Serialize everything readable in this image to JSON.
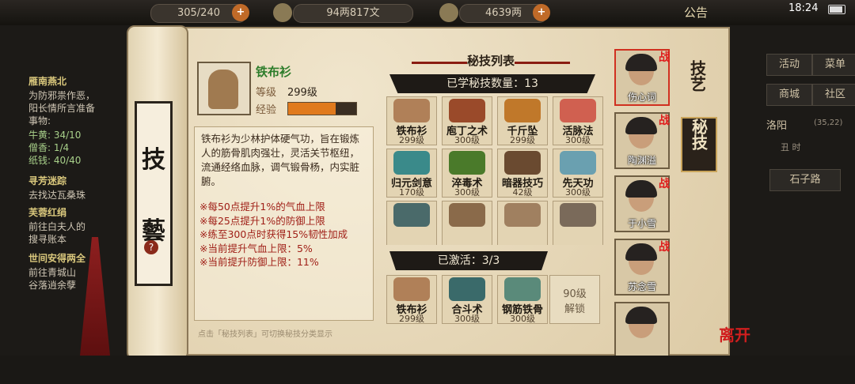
{
  "topbar": {
    "res1": "305/240",
    "res2": "94两817文",
    "res3": "4639两",
    "notice": "公告",
    "clock": "18:24"
  },
  "quests": {
    "q1_title": "雁南燕北",
    "q1_lines": [
      "为防邪祟作恶，",
      "阳长情所言准备",
      "事物:"
    ],
    "q1_items": [
      "牛黄: 34/10",
      "僧香: 1/4",
      "纸钱: 40/40"
    ],
    "q2_title": "寻芳迷踪",
    "q2_line": "去找达瓦桑珠",
    "q3_title": "芙蓉红绢",
    "q3_lines": [
      "前往白夫人的",
      "搜寻账本"
    ],
    "q4_title": "世间安得两全",
    "q4_lines": [
      "前往青城山",
      "谷落逍余孽"
    ]
  },
  "right_menu": {
    "b1": "活动",
    "b2": "菜单",
    "b3": "商城",
    "b4": "社区",
    "location": "洛阳",
    "coords": "(35,22)",
    "time": "丑 时",
    "road": "石子路"
  },
  "scroll_label": {
    "c1": "技",
    "c2": "藝",
    "help": "?"
  },
  "skill": {
    "name": "铁布衫",
    "level_label": "等级",
    "level": "299级",
    "exp_label": "经验",
    "exp_fraction": 0.7,
    "desc": "铁布衫为少林护体硬气功，旨在锻炼人的筋骨肌肉强壮，灵活关节枢纽，流通经络血脉，调气锻骨杨，内实脏腑。",
    "effects": [
      "※每50点提升1%的气血上限",
      "※每25点提升1%的防御上限",
      "※练至300点时获得15%韧性加成",
      "※当前提升气血上限：5%",
      "※当前提升防御上限：11%"
    ],
    "hint": "点击「秘技列表」可切换秘技分类显示"
  },
  "list": {
    "title": "秘技列表",
    "learned": "已学秘技数量：13",
    "active": "已激活：3/3",
    "lock_level": "90级",
    "lock_text": "解锁"
  },
  "skills": [
    {
      "name": "铁布衫",
      "level": "299级",
      "color": "#b08058"
    },
    {
      "name": "庖丁之术",
      "level": "300级",
      "color": "#9a4a2a"
    },
    {
      "name": "千斤坠",
      "level": "299级",
      "color": "#c0782a"
    },
    {
      "name": "活脉法",
      "level": "300级",
      "color": "#d06050"
    },
    {
      "name": "归元剑意",
      "level": "170级",
      "color": "#3a8a8a"
    },
    {
      "name": "淬毒术",
      "level": "300级",
      "color": "#4a7a2a"
    },
    {
      "name": "暗器技巧",
      "level": "42级",
      "color": "#6a4a30"
    },
    {
      "name": "先天功",
      "level": "300级",
      "color": "#6aa0b0"
    },
    {
      "name": "",
      "level": "",
      "color": "#4a6a6a"
    },
    {
      "name": "",
      "level": "",
      "color": "#8a6a4a"
    },
    {
      "name": "",
      "level": "",
      "color": "#a08060"
    },
    {
      "name": "",
      "level": "",
      "color": "#7a6a5a"
    }
  ],
  "active_skills": [
    {
      "name": "铁布衫",
      "level": "299级",
      "color": "#b08058"
    },
    {
      "name": "合斗术",
      "level": "300级",
      "color": "#3a6a6a"
    },
    {
      "name": "钢筋铁骨",
      "level": "300级",
      "color": "#5a8a7a"
    }
  ],
  "characters": [
    {
      "name": "伤心词",
      "battle": "战"
    },
    {
      "name": "陶渊溢",
      "battle": "战"
    },
    {
      "name": "于小雪",
      "battle": "战"
    },
    {
      "name": "苏念雪",
      "battle": "战"
    },
    {
      "name": "",
      "battle": ""
    }
  ],
  "tabs": {
    "t1": "技艺",
    "t2": "秘技"
  },
  "leave": "离开"
}
